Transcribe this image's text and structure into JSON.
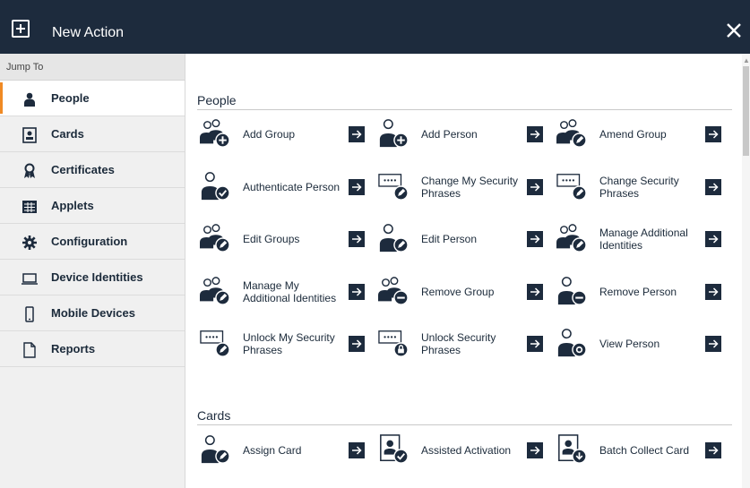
{
  "window": {
    "title": "New Action"
  },
  "sidebar": {
    "jump_to": "Jump To",
    "items": [
      {
        "label": "People",
        "icon": "person-icon",
        "active": true
      },
      {
        "label": "Cards",
        "icon": "card-icon"
      },
      {
        "label": "Certificates",
        "icon": "certificate-icon"
      },
      {
        "label": "Applets",
        "icon": "applet-icon"
      },
      {
        "label": "Configuration",
        "icon": "gear-icon"
      },
      {
        "label": "Device Identities",
        "icon": "laptop-icon"
      },
      {
        "label": "Mobile Devices",
        "icon": "phone-icon"
      },
      {
        "label": "Reports",
        "icon": "document-icon"
      }
    ]
  },
  "sections": [
    {
      "title": "People",
      "actions": [
        {
          "label": "Add Group",
          "icon": "group-add-icon"
        },
        {
          "label": "Add Person",
          "icon": "person-add-icon"
        },
        {
          "label": "Amend Group",
          "icon": "group-edit-icon"
        },
        {
          "label": "Authenticate Person",
          "icon": "person-check-icon"
        },
        {
          "label": "Change My Security Phrases",
          "icon": "phrase-edit-icon"
        },
        {
          "label": "Change Security Phrases",
          "icon": "phrase-edit-icon"
        },
        {
          "label": "Edit Groups",
          "icon": "group-edit-icon"
        },
        {
          "label": "Edit Person",
          "icon": "person-edit-icon"
        },
        {
          "label": "Manage Additional Identities",
          "icon": "group-edit-icon"
        },
        {
          "label": "Manage My Additional Identities",
          "icon": "group-edit-icon"
        },
        {
          "label": "Remove Group",
          "icon": "group-remove-icon"
        },
        {
          "label": "Remove Person",
          "icon": "person-remove-icon"
        },
        {
          "label": "Unlock My Security Phrases",
          "icon": "phrase-edit-icon"
        },
        {
          "label": "Unlock Security Phrases",
          "icon": "phrase-lock-icon"
        },
        {
          "label": "View Person",
          "icon": "person-view-icon"
        }
      ]
    },
    {
      "title": "Cards",
      "actions": [
        {
          "label": "Assign Card",
          "icon": "person-edit-icon"
        },
        {
          "label": "Assisted Activation",
          "icon": "card-check-icon"
        },
        {
          "label": "Batch Collect Card",
          "icon": "card-download-icon"
        }
      ]
    }
  ],
  "colors": {
    "titlebar": "#1d2b3d",
    "accent": "#f08a24",
    "arrow_button": "#1d2b3d"
  }
}
